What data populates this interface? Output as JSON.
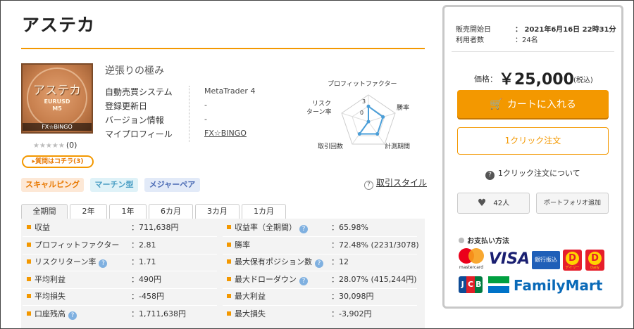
{
  "product": {
    "title": "アステカ",
    "subtitle": "逆張りの極み",
    "image": {
      "name": "アステカ",
      "pair": "EURUSD",
      "timeframe": "M5",
      "brand": "FX☆BINGO"
    },
    "rating_stars": "★★★★★",
    "rating_count": "(0)",
    "qa_link": "▸質問はコチラ(3)"
  },
  "spec": [
    {
      "label": "自動売買システム",
      "value": "MetaTrader 4"
    },
    {
      "label": "登録更新日",
      "value": "-"
    },
    {
      "label": "バージョン情報",
      "value": "-"
    },
    {
      "label": "マイプロフィール",
      "value": "FX☆BINGO"
    }
  ],
  "radar": {
    "axes": [
      "プロフィットファクター",
      "勝率",
      "計測期間",
      "取引回数",
      "リスク\nターン率"
    ],
    "axis_labels_display": {
      "pf": "プロフィットファクター",
      "win": "勝率",
      "period": "計測期間",
      "trades": "取引回数",
      "risk1": "リスク",
      "risk2": "ターン率"
    },
    "scale_marks": [
      "3",
      "0"
    ],
    "values": [
      3,
      3,
      3,
      3,
      0
    ],
    "max": 5,
    "color": "#4a9ed8"
  },
  "tags": [
    "スキャルピング",
    "マーチン型",
    "メジャーペア"
  ],
  "trade_style": {
    "icon": "?",
    "label": "取引スタイル"
  },
  "tabs": [
    "全期間",
    "2年",
    "1年",
    "6カ月",
    "3カ月",
    "1カ月"
  ],
  "stats_left": [
    {
      "label": "収益",
      "value": "：711,638円",
      "help": false
    },
    {
      "label": "プロフィットファクター",
      "value": "：2.81",
      "help": false
    },
    {
      "label": "リスクリターン率",
      "value": "：1.71",
      "help": true
    },
    {
      "label": "平均利益",
      "value": "：490円",
      "help": false
    },
    {
      "label": "平均損失",
      "value": "：-458円",
      "help": false
    },
    {
      "label": "口座残高",
      "value": "：1,711,638円",
      "help": true
    }
  ],
  "stats_right": [
    {
      "label": "収益率（全期間）",
      "value": "：65.98%",
      "help": true
    },
    {
      "label": "勝率",
      "value": "：72.48% (2231/3078)",
      "help": false
    },
    {
      "label": "最大保有ポジション数",
      "value": "：12",
      "help": true
    },
    {
      "label": "最大ドローダウン",
      "value": "：28.07% (415,244円)",
      "help": true
    },
    {
      "label": "最大利益",
      "value": "：30,098円",
      "help": false
    },
    {
      "label": "最大損失",
      "value": "：-3,902円",
      "help": false
    }
  ],
  "sidebar": {
    "sale_start_label": "販売開始日",
    "sale_start_value": "：  2021年6月16日 22時31分",
    "users_label": "利用者数",
    "users_value": "：24名",
    "price_label": "価格：",
    "price": "￥25,000",
    "tax": "(税込)",
    "cart_button": "カートに入れる",
    "oneclick_button": "1クリック注文",
    "oneclick_about": "1クリック注文について",
    "fav_count": "42人",
    "portfolio_button": "ポートフォリオ追加",
    "payment_title": "お支払い方法",
    "payment_methods": {
      "mastercard": "mastercard",
      "visa": "VISA",
      "bank": "銀行振込",
      "dy_letter": "D",
      "dy1_sub": "デイリー",
      "dy2_sub": "Daily",
      "jcb_j": "J",
      "jcb_c": "C",
      "jcb_b": "B",
      "familymart": "FamilyMart"
    }
  },
  "colors": {
    "accent": "#f39800",
    "link_blue": "#4a9ed8",
    "panel_border": "#c8c8c8"
  }
}
